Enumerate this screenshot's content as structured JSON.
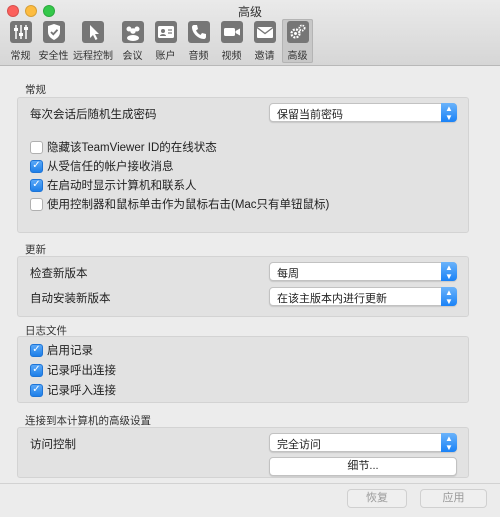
{
  "window": {
    "title": "高级"
  },
  "toolbar": {
    "items": [
      {
        "label": "常规",
        "icon": "sliders-icon"
      },
      {
        "label": "安全性",
        "icon": "shield-icon"
      },
      {
        "label": "远程控制",
        "icon": "cursor-icon"
      },
      {
        "label": "会议",
        "icon": "meeting-icon"
      },
      {
        "label": "账户",
        "icon": "account-card-icon"
      },
      {
        "label": "音频",
        "icon": "phone-icon"
      },
      {
        "label": "视频",
        "icon": "camera-icon"
      },
      {
        "label": "邀请",
        "icon": "envelope-icon"
      },
      {
        "label": "高级",
        "icon": "gears-icon",
        "selected": true
      }
    ]
  },
  "general": {
    "title": "常规",
    "password_label": "每次会话后随机生成密码",
    "password_value": "保留当前密码",
    "checkboxes": [
      {
        "label": "隐藏该TeamViewer ID的在线状态",
        "checked": false
      },
      {
        "label": "从受信任的帐户接收消息",
        "checked": true
      },
      {
        "label": "在启动时显示计算机和联系人",
        "checked": true
      },
      {
        "label": "使用控制器和鼠标单击作为鼠标右击(Mac只有单钮鼠标)",
        "checked": false
      }
    ]
  },
  "update": {
    "title": "更新",
    "check_label": "检查新版本",
    "check_value": "每周",
    "install_label": "自动安装新版本",
    "install_value": "在该主版本内进行更新"
  },
  "log": {
    "title": "日志文件",
    "checkboxes": [
      {
        "label": "启用记录",
        "checked": true
      },
      {
        "label": "记录呼出连接",
        "checked": true
      },
      {
        "label": "记录呼入连接",
        "checked": true
      }
    ]
  },
  "advanced": {
    "title": "连接到本计算机的高级设置",
    "access_label": "访问控制",
    "access_value": "完全访问",
    "details_button": "细节..."
  },
  "footer": {
    "revert_button": "恢复",
    "apply_button": "应用"
  },
  "colors": {
    "accent": "#1a82f7"
  }
}
